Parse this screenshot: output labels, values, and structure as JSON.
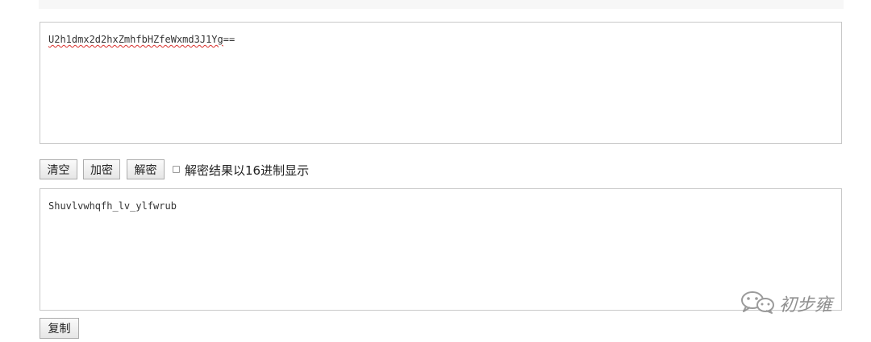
{
  "input": {
    "text_underlined": "U2h1dmx2d2hxZmhfbHZfeWxmd3J1Yg",
    "text_suffix": "=="
  },
  "toolbar": {
    "clear_label": "清空",
    "encrypt_label": "加密",
    "decrypt_label": "解密",
    "hex_checkbox_label": "解密结果以16进制显示",
    "hex_checkbox_checked": false
  },
  "output": {
    "text": "Shuvlvwhqfh_lv_ylfwrub"
  },
  "copy_label": "复制",
  "watermark": {
    "icon": "wechat-icon",
    "text": "初步雍"
  }
}
